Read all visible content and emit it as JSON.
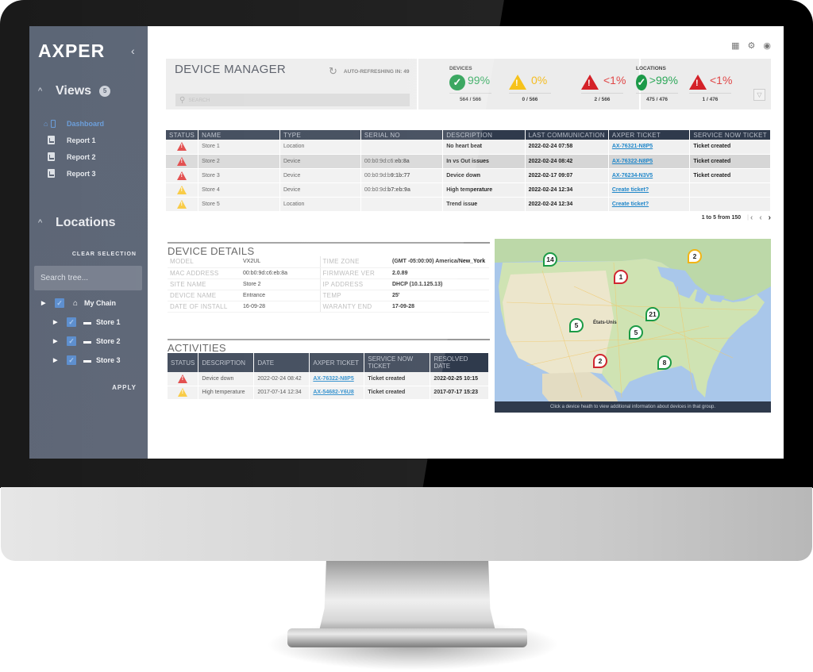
{
  "sidebar": {
    "logo": "AXPER",
    "collapse_icon": "chevron-left-icon",
    "views": {
      "title": "Views",
      "count": "5",
      "items": [
        {
          "label": "Dashboard",
          "icon": "home-device-icon",
          "active": true
        },
        {
          "label": "Report 1",
          "icon": "report-icon",
          "active": false
        },
        {
          "label": "Report 2",
          "icon": "report-icon",
          "active": false
        },
        {
          "label": "Report 3",
          "icon": "report-icon",
          "active": false
        }
      ]
    },
    "locations": {
      "title": "Locations",
      "clear_label": "CLEAR SELECTION",
      "search_placeholder": "Search tree...",
      "tree": [
        {
          "label": "My Chain",
          "icon": "chain-icon",
          "checked": true
        },
        {
          "label": "Store 1",
          "icon": "store-icon",
          "checked": true
        },
        {
          "label": "Store 2",
          "icon": "store-icon",
          "checked": true
        },
        {
          "label": "Store 3",
          "icon": "store-icon",
          "checked": true
        }
      ],
      "apply_label": "APPLY"
    }
  },
  "top_icons": [
    "grid-icon",
    "gear-icon",
    "user-icon"
  ],
  "header": {
    "title": "DEVICE MANAGER",
    "refresh_label": "AUTO-REFRESHING IN: 49",
    "search_placeholder": "SEARCH",
    "devices": {
      "label": "DEVICES",
      "stats": [
        {
          "status": "ok",
          "pct": "99%",
          "count": "564 / 566",
          "color": "#1d9a49"
        },
        {
          "status": "warning",
          "pct": "0%",
          "count": "0 / 566",
          "color": "#f6c21b"
        },
        {
          "status": "error",
          "pct": "<1%",
          "count": "2 / 566",
          "color": "#e04848"
        }
      ]
    },
    "locations": {
      "label": "LOCATIONS",
      "stats": [
        {
          "status": "ok",
          "pct": ">99%",
          "count": "475 / 476",
          "color": "#1d9a49"
        },
        {
          "status": "error",
          "pct": "<1%",
          "count": "1 / 476",
          "color": "#e04848"
        }
      ]
    }
  },
  "main_table": {
    "columns": [
      "STATUS",
      "NAME",
      "TYPE",
      "SERIAL NO",
      "DESCRIPTION",
      "LAST COMMUNICATION",
      "AXPER TICKET",
      "SERVICE NOW TICKET"
    ],
    "rows": [
      {
        "status": "error",
        "name": "Store 1",
        "type": "Location",
        "serial_prefix": "",
        "serial_suffix": "",
        "description": "No heart beat",
        "last_comm": "2022-02-24 07:58",
        "axper_ticket": "AX-76321-N8P5",
        "service_now": "Ticket created",
        "selected": false
      },
      {
        "status": "error",
        "name": "Store 2",
        "type": "Device",
        "serial_prefix": "00:b0:9d:c6:",
        "serial_suffix": "eb:8a",
        "description": "In vs Out issues",
        "last_comm": "2022-02-24 08:42",
        "axper_ticket": "AX-76322-N8P5",
        "service_now": "Ticket created",
        "selected": true
      },
      {
        "status": "error",
        "name": "Store 3",
        "type": "Device",
        "serial_prefix": "00:b0:9d:b",
        "serial_suffix": "9:1b:77",
        "description": "Device down",
        "last_comm": "2022-02-17 09:07",
        "axper_ticket": "AX-76234-N3V5",
        "service_now": "Ticket created",
        "selected": false
      },
      {
        "status": "warning",
        "name": "Store 4",
        "type": "Device",
        "serial_prefix": "00:b0:9d:",
        "serial_suffix": "b7:eb:9a",
        "description": "High temperature",
        "last_comm": "2022-02-24 12:34",
        "axper_ticket": "Create ticket?",
        "service_now": "",
        "selected": false
      },
      {
        "status": "warning",
        "name": "Store 5",
        "type": "Location",
        "serial_prefix": "",
        "serial_suffix": "",
        "description": "Trend issue",
        "last_comm": "2022-02-24 12:34",
        "axper_ticket": "Create ticket?",
        "service_now": "",
        "selected": false
      }
    ],
    "pager": {
      "label": "1 to 5 from 150"
    }
  },
  "device_details": {
    "title": "DEVICE DETAILS",
    "left": [
      {
        "key": "MODEL",
        "value": "VX2UL"
      },
      {
        "key": "MAC ADDRESS",
        "value": "00:b0:9d:c6:eb:8a"
      },
      {
        "key": "SITE NAME",
        "value": "Store 2"
      },
      {
        "key": "DEVICE NAME",
        "value": "Entrance"
      },
      {
        "key": "DATE OF INSTALL",
        "value": "16-09-28"
      }
    ],
    "right": [
      {
        "key": "TIME ZONE",
        "value": "(GMT -05:00:00) America/New_York"
      },
      {
        "key": "FIRMWARE VER",
        "value": "2.0.89"
      },
      {
        "key": "IP ADDRESS",
        "value": "DHCP (10.1.125.13)"
      },
      {
        "key": "TEMP",
        "value": "25'"
      },
      {
        "key": "WARANTY END",
        "value": "17-09-28"
      }
    ]
  },
  "activities": {
    "title": "ACTIVITIES",
    "columns": [
      "STATUS",
      "DESCRIPTION",
      "DATE",
      "AXPER TICKET",
      "SERVICE NOW TICKET",
      "RESOLVED DATE"
    ],
    "rows": [
      {
        "status": "error",
        "description": "Device down",
        "date": "2022-02-24 08:42",
        "axper_ticket": "AX-76322-N8P5",
        "service_now": "Ticket created",
        "resolved": "2022-02-25 10:15"
      },
      {
        "status": "warning",
        "description": "High temperature",
        "date": "2017-07-14 12:34",
        "axper_ticket": "AX-54682-Y6U8",
        "service_now": "Ticket created",
        "resolved": "2017-07-17 15:23"
      }
    ]
  },
  "map": {
    "center_label": "États-Unis",
    "caption": "Click a device heath to view additional information about devices in that group.",
    "markers": [
      {
        "count": "14",
        "status": "green"
      },
      {
        "count": "2",
        "status": "yellow"
      },
      {
        "count": "1",
        "status": "red"
      },
      {
        "count": "21",
        "status": "green"
      },
      {
        "count": "5",
        "status": "green"
      },
      {
        "count": "5",
        "status": "green"
      },
      {
        "count": "2",
        "status": "red"
      },
      {
        "count": "8",
        "status": "green"
      }
    ]
  }
}
